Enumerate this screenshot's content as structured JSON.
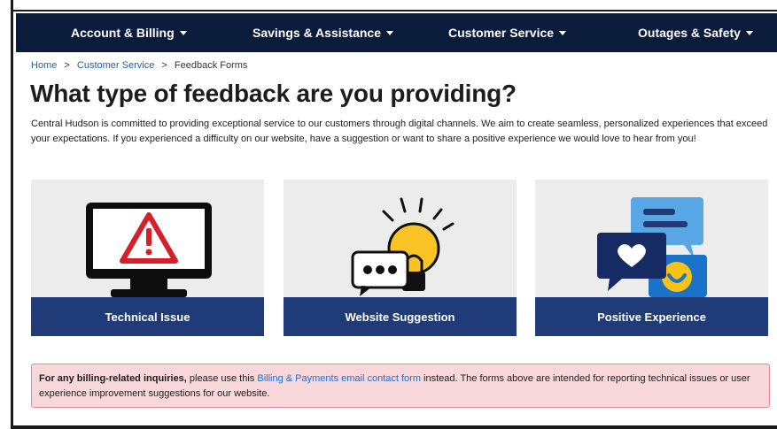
{
  "nav": {
    "items": [
      {
        "label": "Account & Billing"
      },
      {
        "label": "Savings & Assistance"
      },
      {
        "label": "Customer Service"
      },
      {
        "label": "Outages & Safety"
      }
    ]
  },
  "breadcrumb": {
    "home": "Home",
    "customer_service": "Customer Service",
    "current": "Feedback Forms",
    "separator": ">"
  },
  "page": {
    "title": "What type of feedback are you providing?",
    "intro": "Central Hudson is committed to providing exceptional service to our customers through digital channels. We aim to create seamless, personalized experiences that exceed your expectations. If you experienced a difficulty on our website, have a suggestion or want to share a positive experience we would love to hear from you!"
  },
  "cards": [
    {
      "label": "Technical Issue",
      "icon": "monitor-warning-icon"
    },
    {
      "label": "Website Suggestion",
      "icon": "lightbulb-chat-icon"
    },
    {
      "label": "Positive Experience",
      "icon": "chat-heart-icon"
    }
  ],
  "alert": {
    "bold": "For any billing-related inquiries,",
    "pre_link": " please use this ",
    "link": "Billing & Payments email contact form",
    "post_link": " instead. The forms above are intended for reporting technical issues or user experience improvement suggestions for our website."
  },
  "colors": {
    "nav_bg": "#0b1b3a",
    "card_label_bg": "#1f3b78",
    "link": "#1f5fa8",
    "alert_bg": "#f8d7da"
  }
}
